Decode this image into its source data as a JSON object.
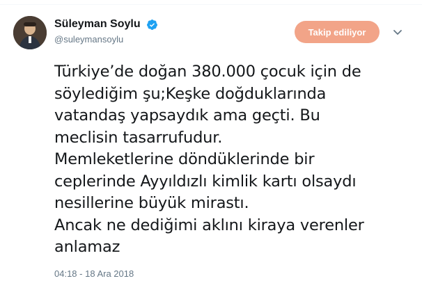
{
  "user": {
    "display_name": "Süleyman Soylu",
    "handle": "@suleymansoylu",
    "verified": true,
    "avatar": "avatar-photo"
  },
  "follow_button": {
    "label": "Takip ediliyor",
    "color": "#f2a488"
  },
  "menu": {
    "icon": "chevron-down-icon"
  },
  "tweet": {
    "lines": [
      "Türkiye’de doğan 380.000 çocuk için de",
      "söylediğim şu;Keşke doğduklarında",
      "vatandaş yapsaydık ama geçti. Bu",
      "meclisin tasarrufudur.",
      "Memleketlerine döndüklerinde bir",
      "ceplerinde Ayyıldızlı kimlik kartı olsaydı",
      "nesillerine büyük mirastı.",
      "Ancak ne dediğimi aklını kiraya verenler",
      "anlamaz"
    ],
    "timestamp": "04:18 - 18 Ara 2018"
  },
  "colors": {
    "verified_badge": "#1da1f2",
    "muted_text": "#657786",
    "text": "#14171a"
  }
}
